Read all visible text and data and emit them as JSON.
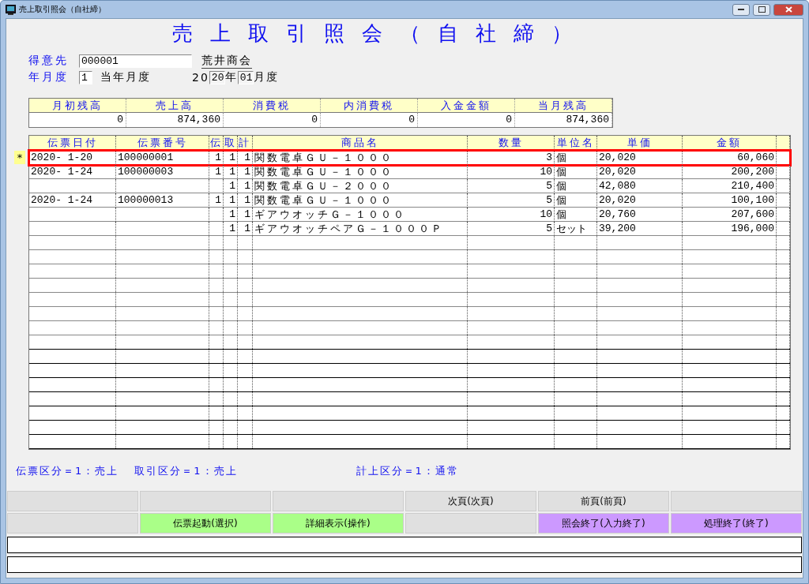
{
  "window": {
    "title": "売上取引照会（自社締）"
  },
  "heading": "売上取引照会（自社締）",
  "customer": {
    "label": "得意先",
    "code": "000001",
    "name": "荒井商会"
  },
  "period": {
    "label": "年月度",
    "value": "1",
    "description": "当年月度",
    "year_prefix": "20",
    "year": "20",
    "year_unit": "年",
    "month": "01",
    "month_unit": "月度"
  },
  "summary": {
    "columns": [
      "月初残高",
      "売上高",
      "消費税",
      "内消費税",
      "入金金額",
      "当月残高"
    ],
    "values": [
      "0",
      "874,360",
      "0",
      "0",
      "0",
      "874,360"
    ]
  },
  "table": {
    "columns": [
      "伝票日付",
      "伝票番号",
      "伝",
      "取",
      "計",
      "商品名",
      "数量",
      "単位名",
      "単価",
      "金額"
    ],
    "rows": [
      {
        "selected": true,
        "marker": "*",
        "cells": [
          "2020- 1-20",
          "100000001",
          "1",
          "1",
          "1",
          "関数電卓ＧＵ－１０００",
          "3",
          "個",
          "20,020",
          "60,060"
        ]
      },
      {
        "selected": false,
        "cells": [
          "2020- 1-24",
          "100000003",
          "1",
          "1",
          "1",
          "関数電卓ＧＵ－１０００",
          "10",
          "個",
          "20,020",
          "200,200"
        ]
      },
      {
        "selected": false,
        "cells": [
          null,
          null,
          null,
          "1",
          "1",
          "関数電卓ＧＵ－２０００",
          "5",
          "個",
          "42,080",
          "210,400"
        ]
      },
      {
        "selected": false,
        "cells": [
          "2020- 1-24",
          "100000013",
          "1",
          "1",
          "1",
          "関数電卓ＧＵ－１０００",
          "5",
          "個",
          "20,020",
          "100,100"
        ]
      },
      {
        "selected": false,
        "cells": [
          null,
          null,
          null,
          "1",
          "1",
          "ギアウオッチＧ－１０００",
          "10",
          "個",
          "20,760",
          "207,600"
        ]
      },
      {
        "selected": false,
        "cells": [
          null,
          null,
          null,
          "1",
          "1",
          "ギアウオッチペアＧ－１０００Ｐ",
          "5",
          "セット",
          "39,200",
          "196,000"
        ]
      }
    ]
  },
  "status": [
    "伝票区分＝1：売上",
    "取引区分＝1：売上",
    "計上区分＝1：通常"
  ],
  "function_keys": [
    [
      {
        "label": "次頁(次頁)"
      },
      {
        "label": "前頁(前頁)"
      }
    ],
    [
      {
        "label": "伝票起動(選択)",
        "color": "#aaff88"
      },
      {
        "label": "詳細表示(操作)",
        "color": "#aaff88"
      },
      {
        "label": "照会終了(入力終了)",
        "color": "#cc99ff"
      },
      {
        "label": "処理終了(終了)",
        "color": "#cc99ff"
      }
    ]
  ]
}
